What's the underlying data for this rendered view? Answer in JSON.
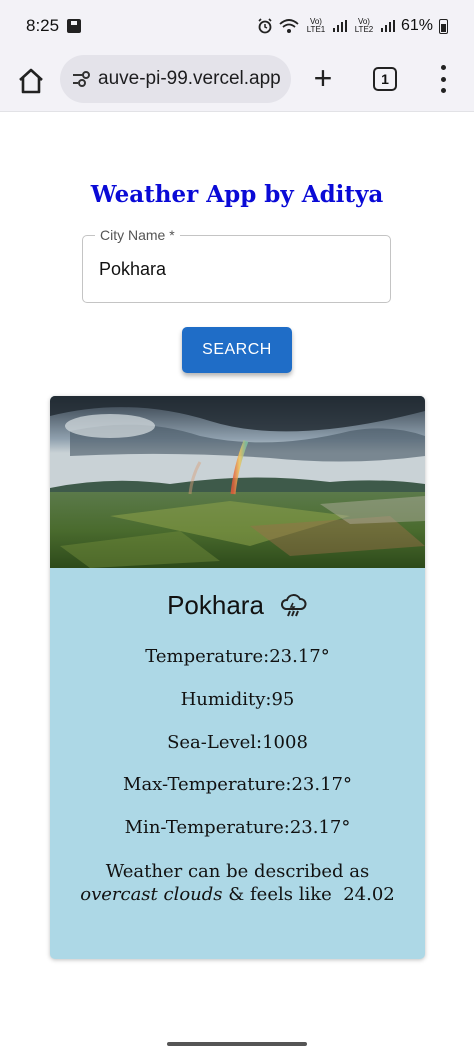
{
  "status_bar": {
    "time": "8:25",
    "signal_1": "Vo) LTE1",
    "signal_2": "Vo) LTE2",
    "battery": "61%"
  },
  "browser": {
    "url": "auve-pi-99.vercel.app",
    "tab_count": "1",
    "new_tab_label": "+"
  },
  "app": {
    "title": "Weather App by Aditya",
    "city_field": {
      "label": "City Name *",
      "value": "Pokhara"
    },
    "search_label": "SEARCH",
    "card": {
      "city": "Pokhara",
      "icon": "thunderstorm-icon",
      "temperature": "Temperature:23.17°",
      "humidity": "Humidity:95",
      "sea_level": "Sea-Level:1008",
      "max_temperature": "Max-Temperature:23.17°",
      "min_temperature": "Min-Temperature:23.17°",
      "description_prefix": "Weather can be described as",
      "description_condition": "overcast clouds",
      "description_middle": "& feels like",
      "feels_like": "24.02"
    }
  },
  "colors": {
    "title": "#0a0ad6",
    "button": "#1f6dc7",
    "card_body": "#add8e6"
  }
}
